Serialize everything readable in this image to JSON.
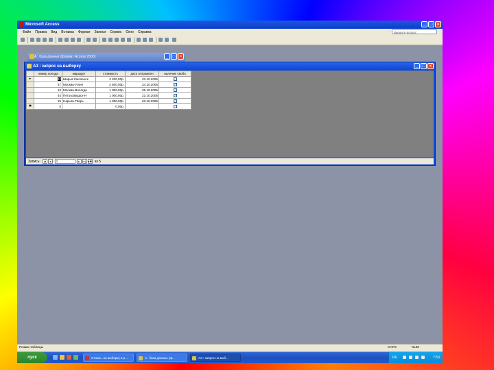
{
  "app": {
    "title": "Microsoft Access",
    "help_placeholder": "Введите вопрос"
  },
  "menu": [
    "Файл",
    "Правка",
    "Вид",
    "Вставка",
    "Формат",
    "Записи",
    "Сервис",
    "Окно",
    "Справка"
  ],
  "db_window": {
    "title": "A : база данных (формат Access 2000)"
  },
  "query_window": {
    "title": "А3 : запрос на выборку",
    "columns": [
      "номер поезда",
      "маршрут",
      "стоимость",
      "дата отправлен",
      "наличие свобо"
    ],
    "rows": [
      {
        "selector": "▸",
        "num": "42",
        "route": "Шарья-Смоленск",
        "cost": "2 200,00р.",
        "date": "23.10.2005",
        "checked": true
      },
      {
        "selector": "",
        "num": "47",
        "route": "Москва-Углич",
        "cost": "2 500,00р.",
        "date": "24.10.2005",
        "checked": true
      },
      {
        "selector": "",
        "num": "13",
        "route": "Москва-Вологда",
        "cost": "1 000,00р.",
        "date": "25.10.2005",
        "checked": true
      },
      {
        "selector": "",
        "num": "44",
        "route": "Петрозаводск-Н",
        "cost": "1 000,00р.",
        "date": "22.10.2005",
        "checked": true
      },
      {
        "selector": "",
        "num": "19",
        "route": "Нарьян-Тверь",
        "cost": "1 000,00р.",
        "date": "23.10.2005",
        "checked": true
      },
      {
        "selector": "✱",
        "num": "0",
        "route": "",
        "cost": "0,00р.",
        "date": "",
        "checked": false
      }
    ],
    "nav": {
      "label": "Запись:",
      "current": "1",
      "total": "из 5"
    }
  },
  "statusbar": {
    "left": "Режим таблицы",
    "caps": "CAPS",
    "num": "NUM"
  },
  "taskbar": {
    "start": "пуск",
    "tasks": [
      {
        "label": "Стоим...на выборку в р..."
      },
      {
        "label": "A : база данных (ф..."
      },
      {
        "label": "А3 : запрос на выб..."
      }
    ],
    "lang": "RU",
    "clock": "7:53"
  },
  "colors": {
    "titlebar": "#0c45d2",
    "desktop": "#8c93a6",
    "taskbar": "#2459c9"
  }
}
